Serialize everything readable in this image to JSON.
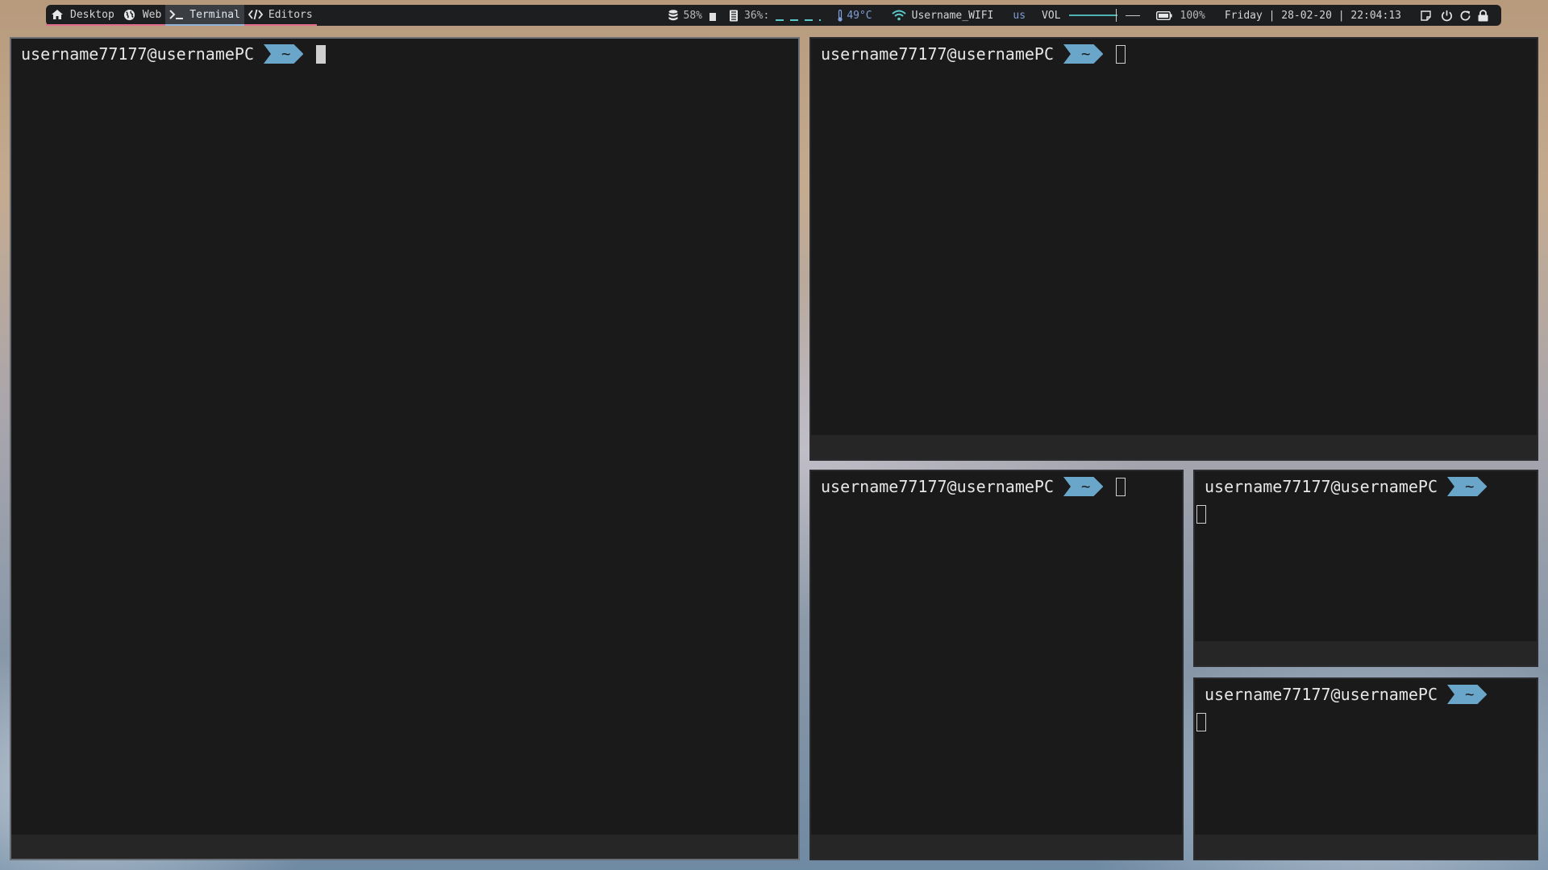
{
  "workspaces": [
    {
      "label": "Desktop",
      "icon": "home-icon"
    },
    {
      "label": "Web",
      "icon": "globe-icon"
    },
    {
      "label": "Terminal",
      "icon": "terminal-icon"
    },
    {
      "label": "Editors",
      "icon": "code-icon"
    }
  ],
  "status": {
    "disk": "58%",
    "memory": "36%:",
    "temperature": "49°C",
    "wifi": "Username_WIFI",
    "keyboard_layout": "us",
    "volume_label": "VOL",
    "battery": "100%",
    "datetime": "Friday | 28-02-20 | 22:04:13"
  },
  "terminals": [
    {
      "user_host": "username77177@usernamePC",
      "dir": "~"
    },
    {
      "user_host": "username77177@usernamePC",
      "dir": "~"
    },
    {
      "user_host": "username77177@usernamePC",
      "dir": "~"
    },
    {
      "user_host": "username77177@usernamePC",
      "dir": "~"
    },
    {
      "user_host": "username77177@usernamePC",
      "dir": "~"
    }
  ],
  "colors": {
    "accent": "#6aa6c9",
    "workspace_underline": "#e06c8c",
    "active_underline": "#8fb3d9"
  }
}
